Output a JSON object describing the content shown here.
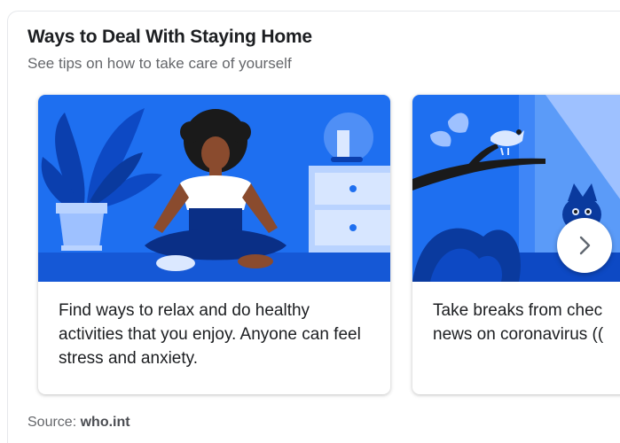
{
  "header": {
    "title": "Ways to Deal With Staying Home",
    "subtitle": "See tips on how to take care of yourself"
  },
  "cards": [
    {
      "illustration": "person-meditating-illustration",
      "text": "Find ways to relax and do healthy activities that you enjoy. Anyone can feel stress and anxiety."
    },
    {
      "illustration": "bird-cat-window-illustration",
      "text": "Take breaks from chec\nnews on coronavirus (("
    }
  ],
  "carousel": {
    "next_icon": "chevron-right-icon"
  },
  "footer": {
    "source_label": "Source:",
    "source_value": "who.int"
  },
  "colors": {
    "illustration_blue": "#1e6ff0",
    "text_primary": "#1c1e21",
    "text_secondary": "#65676b"
  }
}
